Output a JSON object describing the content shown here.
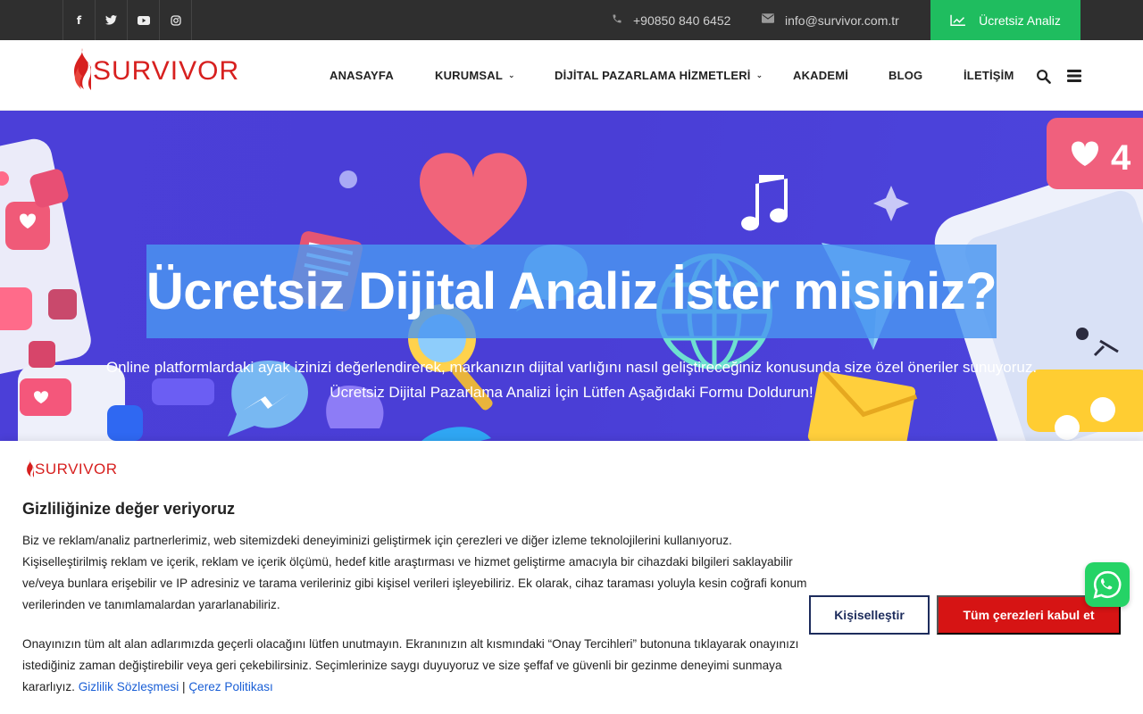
{
  "topbar": {
    "social": [
      {
        "name": "facebook-icon",
        "glyph": "f"
      },
      {
        "name": "twitter-icon",
        "glyph": "t"
      },
      {
        "name": "youtube-icon",
        "glyph": "▶"
      },
      {
        "name": "instagram-icon",
        "glyph": "◎"
      }
    ],
    "phone": "+90850 840 6452",
    "email": "info@survivor.com.tr",
    "cta_label": "Ücretsiz Analiz"
  },
  "header": {
    "logo_text": "SURVIVOR",
    "nav": [
      {
        "label": "ANASAYFA",
        "dropdown": false
      },
      {
        "label": "KURUMSAL",
        "dropdown": true
      },
      {
        "label": "DİJİTAL PAZARLAMA HİZMETLERİ",
        "dropdown": true
      },
      {
        "label": "AKADEMİ",
        "dropdown": false
      },
      {
        "label": "BLOG",
        "dropdown": false
      },
      {
        "label": "İLETİŞİM",
        "dropdown": false
      }
    ]
  },
  "hero": {
    "title": "Ücretsiz Dijital Analiz İster misiniz?",
    "subtitle_line1": "Online platformlardaki ayak izinizi değerlendirerek, markanızın dijital varlığını nasıl geliştireceğiniz konusunda size özel öneriler sunuyoruz.",
    "subtitle_line2": "Ücretsiz Dijital Pazarlama Analizi İçin Lütfen Aşağıdaki Formu Doldurun!"
  },
  "cookie": {
    "logo_text": "SURVIVOR",
    "title": "Gizliliğinize değer veriyoruz",
    "paragraph1": "Biz ve reklam/analiz partnerlerimiz, web sitemizdeki deneyiminizi geliştirmek için çerezleri ve diğer izleme teknolojilerini kullanıyoruz. Kişiselleştirilmiş reklam ve içerik, reklam ve içerik ölçümü, hedef kitle araştırması ve hizmet geliştirme amacıyla bir cihazdaki bilgileri saklayabilir ve/veya bunlara erişebilir ve IP adresiniz ve tarama verileriniz gibi kişisel verileri işleyebiliriz. Ek olarak, cihaz taraması yoluyla kesin coğrafi konum verilerinden ve tanımlamalardan yararlanabiliriz.",
    "paragraph2": "Onayınızın tüm alt alan adlarımızda geçerli olacağını lütfen unutmayın. Ekranınızın alt kısmındaki “Onay Tercihleri” butonuna tıklayarak onayınızı istediğiniz zaman değiştirebilir veya geri çekebilirsiniz. Seçimlerinize saygı duyuyoruz ve size şeffaf ve güvenli bir gezinme deneyimi sunmaya kararlıyız.",
    "link1": "Gizlilik Sözleşmesi",
    "separator": "|",
    "link2": "Çerez Politikası",
    "customize_label": "Kişiselleştir",
    "accept_label": "Tüm çerezleri kabul et"
  },
  "colors": {
    "topbar": "#2f2f2f",
    "cta": "#1fbd5f",
    "brand_red": "#d7201f",
    "hero_bg": "#4b3fd8",
    "accept_button": "#d61414",
    "customize_border": "#1d2c5c",
    "whatsapp": "#25d366"
  }
}
